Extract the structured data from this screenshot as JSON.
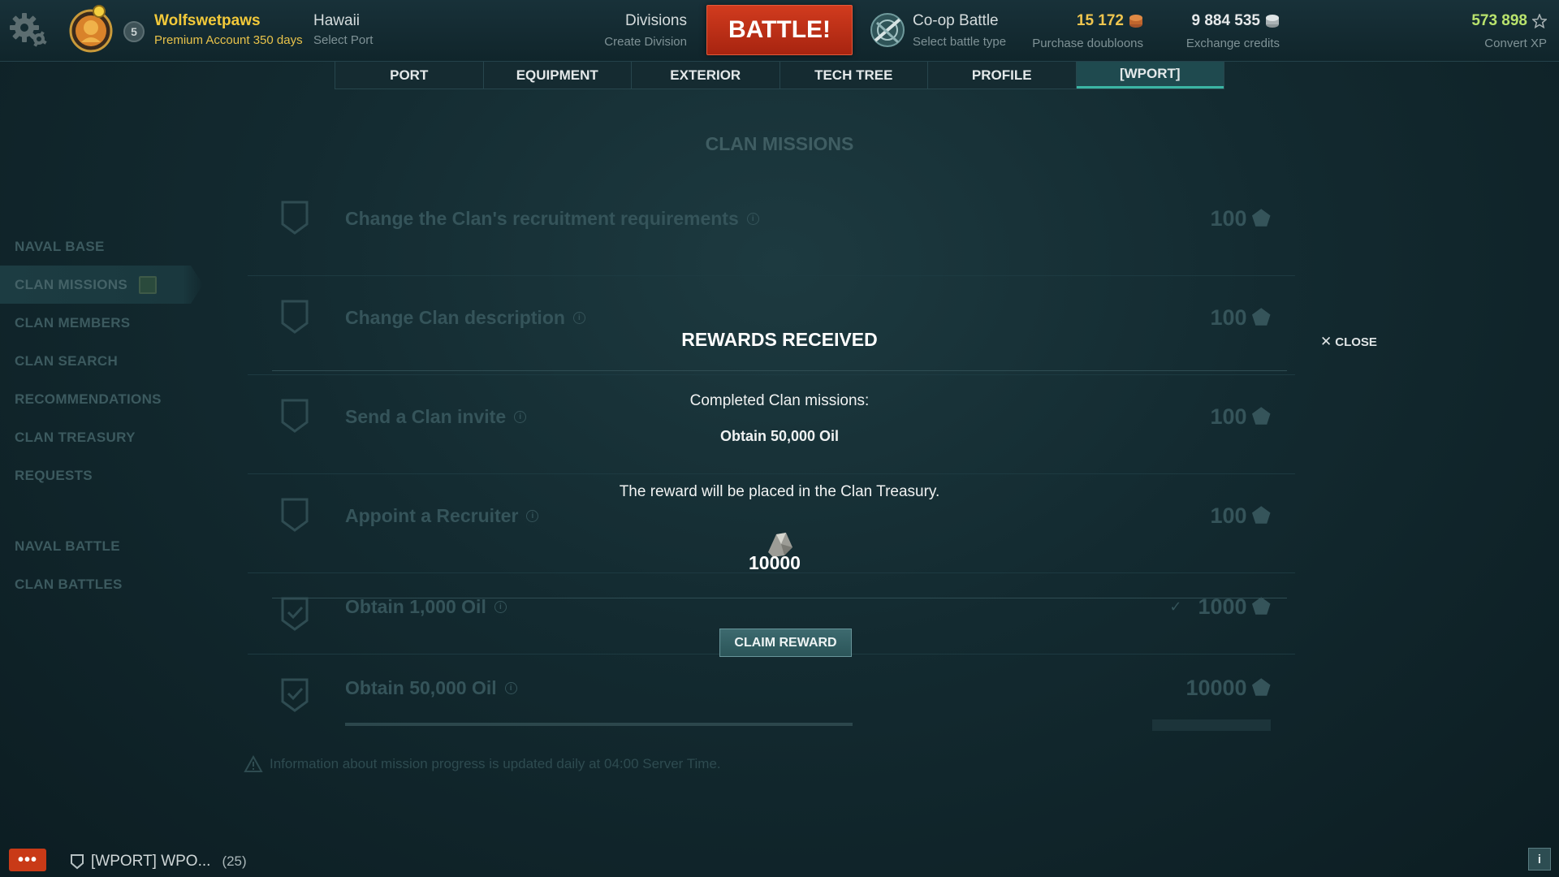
{
  "topbar": {
    "user_name": "Wolfswetpaws",
    "premium": "Premium Account 350 days",
    "level": "5",
    "port_name": "Hawaii",
    "port_sub": "Select Port",
    "divisions_title": "Divisions",
    "divisions_sub": "Create Division",
    "battle_label": "BATTLE!",
    "battle_type": "Co-op Battle",
    "battle_type_sub": "Select battle type",
    "doubloons": "15 172",
    "doubloons_label": "Purchase doubloons",
    "credits": "9 884 535",
    "credits_label": "Exchange credits",
    "free_xp": "573 898",
    "free_xp_label": "Convert XP"
  },
  "tabs": [
    "PORT",
    "EQUIPMENT",
    "EXTERIOR",
    "TECH TREE",
    "PROFILE",
    "[WPORT]"
  ],
  "active_tab": "[WPORT]",
  "page_title": "CLAN MISSIONS",
  "sidebar": {
    "items": [
      "NAVAL BASE",
      "CLAN MISSIONS",
      "CLAN MEMBERS",
      "CLAN SEARCH",
      "RECOMMENDATIONS",
      "CLAN TREASURY",
      "REQUESTS"
    ],
    "items2": [
      "NAVAL BATTLE",
      "CLAN BATTLES"
    ],
    "active": "CLAN MISSIONS"
  },
  "missions": [
    {
      "title": "Change the Clan's recruitment requirements",
      "reward": "100",
      "done": false
    },
    {
      "title": "Change Clan description",
      "reward": "100",
      "done": false
    },
    {
      "title": "Send a Clan invite",
      "reward": "100",
      "done": false
    },
    {
      "title": "Appoint a Recruiter",
      "reward": "100",
      "done": false
    },
    {
      "title": "Obtain 1,000 Oil",
      "reward": "1000",
      "done": true
    },
    {
      "title": "Obtain 50,000 Oil",
      "reward": "10000",
      "done": true
    }
  ],
  "footer_note": "Information about mission progress is updated daily at 04:00 Server Time.",
  "dialog": {
    "title": "REWARDS RECEIVED",
    "close_label": "CLOSE",
    "completed_label": "Completed Clan missions:",
    "mission_name": "Obtain 50,000 Oil",
    "treasury_note": "The reward will be placed in the Clan Treasury.",
    "reward_amount": "10000",
    "claim_label": "CLAIM REWARD"
  },
  "bottom": {
    "chat_label": "•••",
    "clan_chat": "[WPORT] WPO...",
    "clan_chat_count": "(25)",
    "info_label": "i"
  },
  "colors": {
    "battle_button": "#c8361a",
    "accent": "#3bb5a4",
    "doubloons": "#f0c64f",
    "free_xp": "#b9e36d"
  }
}
